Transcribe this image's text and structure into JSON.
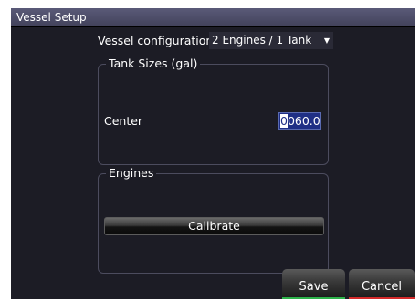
{
  "window": {
    "title": "Vessel Setup"
  },
  "vessel_config": {
    "label": "Vessel configuration",
    "selected": "2 Engines / 1 Tank",
    "arrow_icon": "down-arrow"
  },
  "tank_sizes": {
    "legend": "Tank Sizes (gal)",
    "rows": [
      {
        "label": "Center",
        "value_cursor": "0",
        "value_rest": "060.0"
      }
    ]
  },
  "engines": {
    "legend": "Engines",
    "calibrate_label": "Calibrate"
  },
  "softkeys": {
    "save_label": "Save",
    "save_color": "#2db34a",
    "cancel_label": "Cancel",
    "cancel_color": "#d42a2a"
  }
}
